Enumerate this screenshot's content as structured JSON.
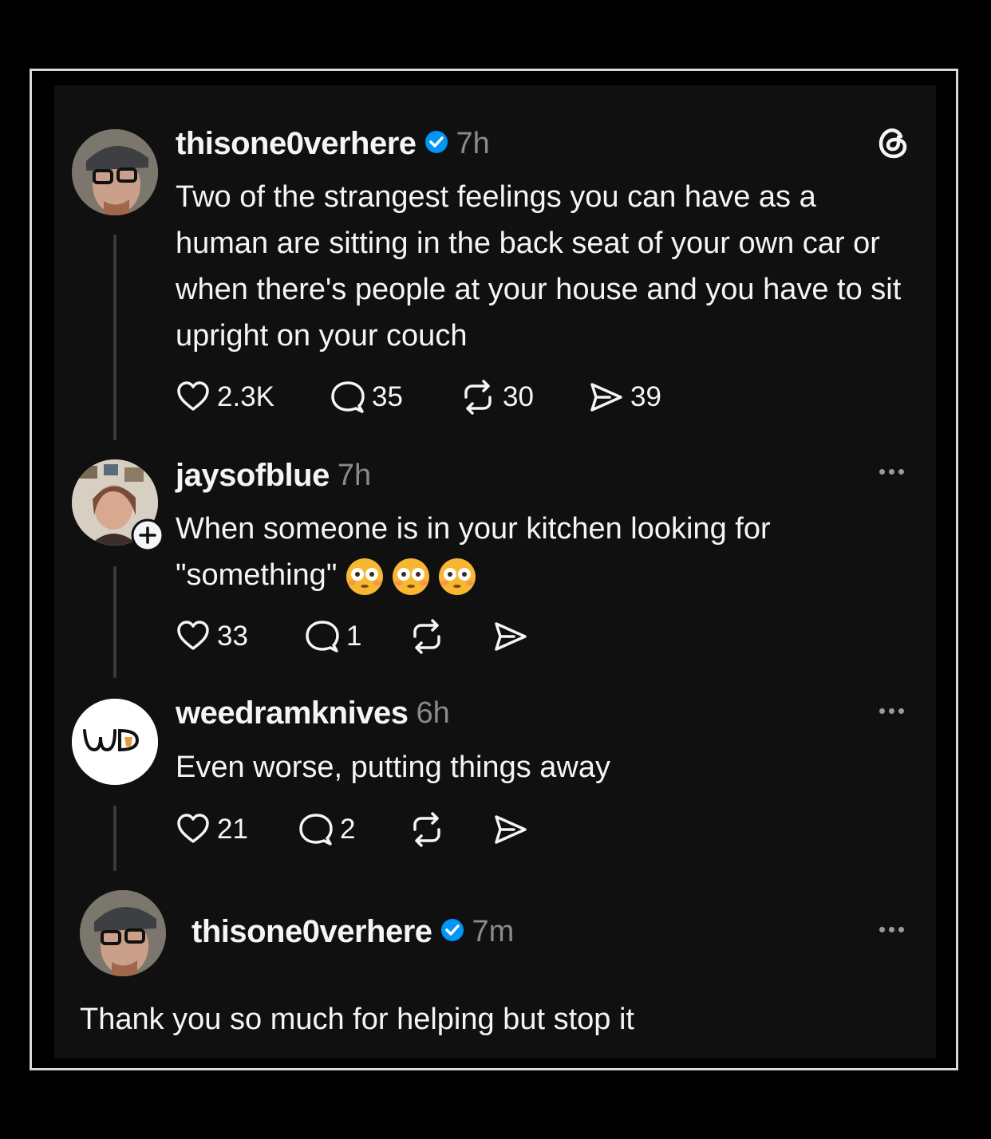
{
  "posts": [
    {
      "username": "thisone0verhere",
      "time": "7h",
      "verified": true,
      "text": "Two of the strangest feelings you can have as a human are sitting in the back seat of your own car or when there's people at your house and you have to sit upright on your couch",
      "likes": "2.3K",
      "replies": "35",
      "reposts": "30",
      "shares": "39"
    },
    {
      "username": "jaysofblue",
      "time": "7h",
      "verified": false,
      "text": "When someone is in your kitchen looking for \"something\"",
      "emoji": "😳😳😳",
      "likes": "33",
      "replies": "1"
    },
    {
      "username": "weedramknives",
      "time": "6h",
      "verified": false,
      "avatar_text": "WD",
      "text": "Even worse, putting things away",
      "likes": "21",
      "replies": "2"
    },
    {
      "username": "thisone0verhere",
      "time": "7m",
      "verified": true,
      "text": "Thank you so much for helping but stop it"
    }
  ],
  "colors": {
    "background": "#101010",
    "text": "#f3f5f7",
    "muted": "#8a8a8a",
    "verified": "#0095f6"
  },
  "icons": [
    "threads-logo-icon",
    "verified-badge-icon",
    "heart-icon",
    "comment-icon",
    "repost-icon",
    "share-icon",
    "more-icon",
    "follow-plus-icon"
  ]
}
